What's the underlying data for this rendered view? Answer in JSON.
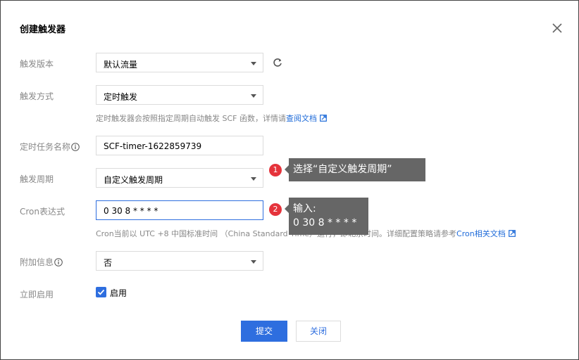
{
  "dialog": {
    "title": "创建触发器"
  },
  "form": {
    "version": {
      "label": "触发版本",
      "value": "默认流量"
    },
    "method": {
      "label": "触发方式",
      "value": "定时触发",
      "hint": "定时触发器会按照指定周期自动触发 SCF 函数，详情请",
      "hint_link": "查阅文档"
    },
    "task_name": {
      "label": "定时任务名称",
      "value": "SCF-timer-1622859739"
    },
    "period": {
      "label": "触发周期",
      "value": "自定义触发周期"
    },
    "cron": {
      "label": "Cron表达式",
      "value": "0 30 8 * * * *",
      "hint": "Cron当前以 UTC +8 中国标准时间 （China Standard Time）运行，即北京时间。详细配置策略请参考",
      "hint_link": "Cron相关文档"
    },
    "extra": {
      "label": "附加信息",
      "value": "否"
    },
    "enable": {
      "label": "立即启用",
      "checkbox_label": "启用",
      "checked": true
    }
  },
  "buttons": {
    "submit": "提交",
    "close": "关闭"
  },
  "annotations": [
    {
      "number": "1",
      "lines": [
        "选择“自定义触发周期”"
      ]
    },
    {
      "number": "2",
      "lines": [
        "输入:",
        "0 30 8 * * * *"
      ]
    }
  ],
  "colors": {
    "primary": "#2e6edf",
    "badge": "#e5333b",
    "callout": "#666666"
  }
}
